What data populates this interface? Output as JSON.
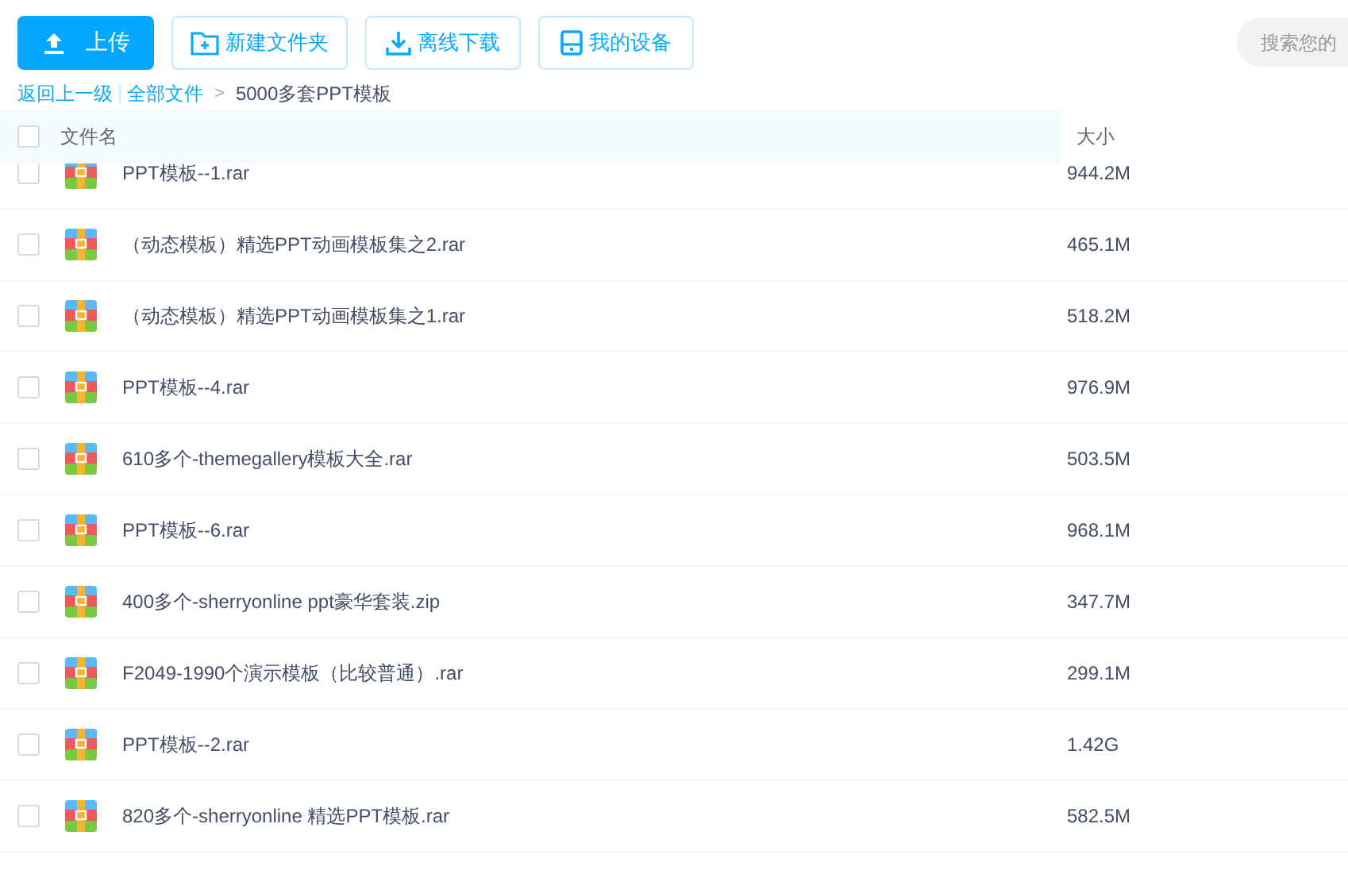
{
  "toolbar": {
    "buttons": [
      {
        "label": "上传",
        "kind": "primary"
      },
      {
        "label": "新建文件夹",
        "kind": "folder"
      },
      {
        "label": "离线下载",
        "kind": "download"
      },
      {
        "label": "我的设备",
        "kind": "device"
      }
    ],
    "search": {
      "placeholder": "搜索您的"
    }
  },
  "breadcrumb": {
    "back": "返回上一级",
    "root": "全部文件",
    "separator": ">",
    "current": "5000多套PPT模板"
  },
  "table": {
    "select_all": {
      "checked": false
    },
    "columns": [
      "文件名",
      "大小"
    ],
    "rows": [
      {
        "name": "PPT模板--1.rar",
        "size": "944.2M",
        "checked": false
      },
      {
        "name": "（动态模板）精选PPT动画模板集之2.rar",
        "size": "465.1M",
        "checked": false
      },
      {
        "name": "（动态模板）精选PPT动画模板集之1.rar",
        "size": "518.2M",
        "checked": false
      },
      {
        "name": "PPT模板--4.rar",
        "size": "976.9M",
        "checked": false
      },
      {
        "name": "610多个-themegallery模板大全.rar",
        "size": "503.5M",
        "checked": false
      },
      {
        "name": "PPT模板--6.rar",
        "size": "968.1M",
        "checked": false
      },
      {
        "name": "400多个-sherryonline ppt豪华套装.zip",
        "size": "347.7M",
        "checked": false
      },
      {
        "name": "F2049-1990个演示模板（比较普通）.rar",
        "size": "299.1M",
        "checked": false
      },
      {
        "name": "PPT模板--2.rar",
        "size": "1.42G",
        "checked": false
      },
      {
        "name": "820多个-sherryonline 精选PPT模板.rar",
        "size": "582.5M",
        "checked": false
      }
    ]
  }
}
